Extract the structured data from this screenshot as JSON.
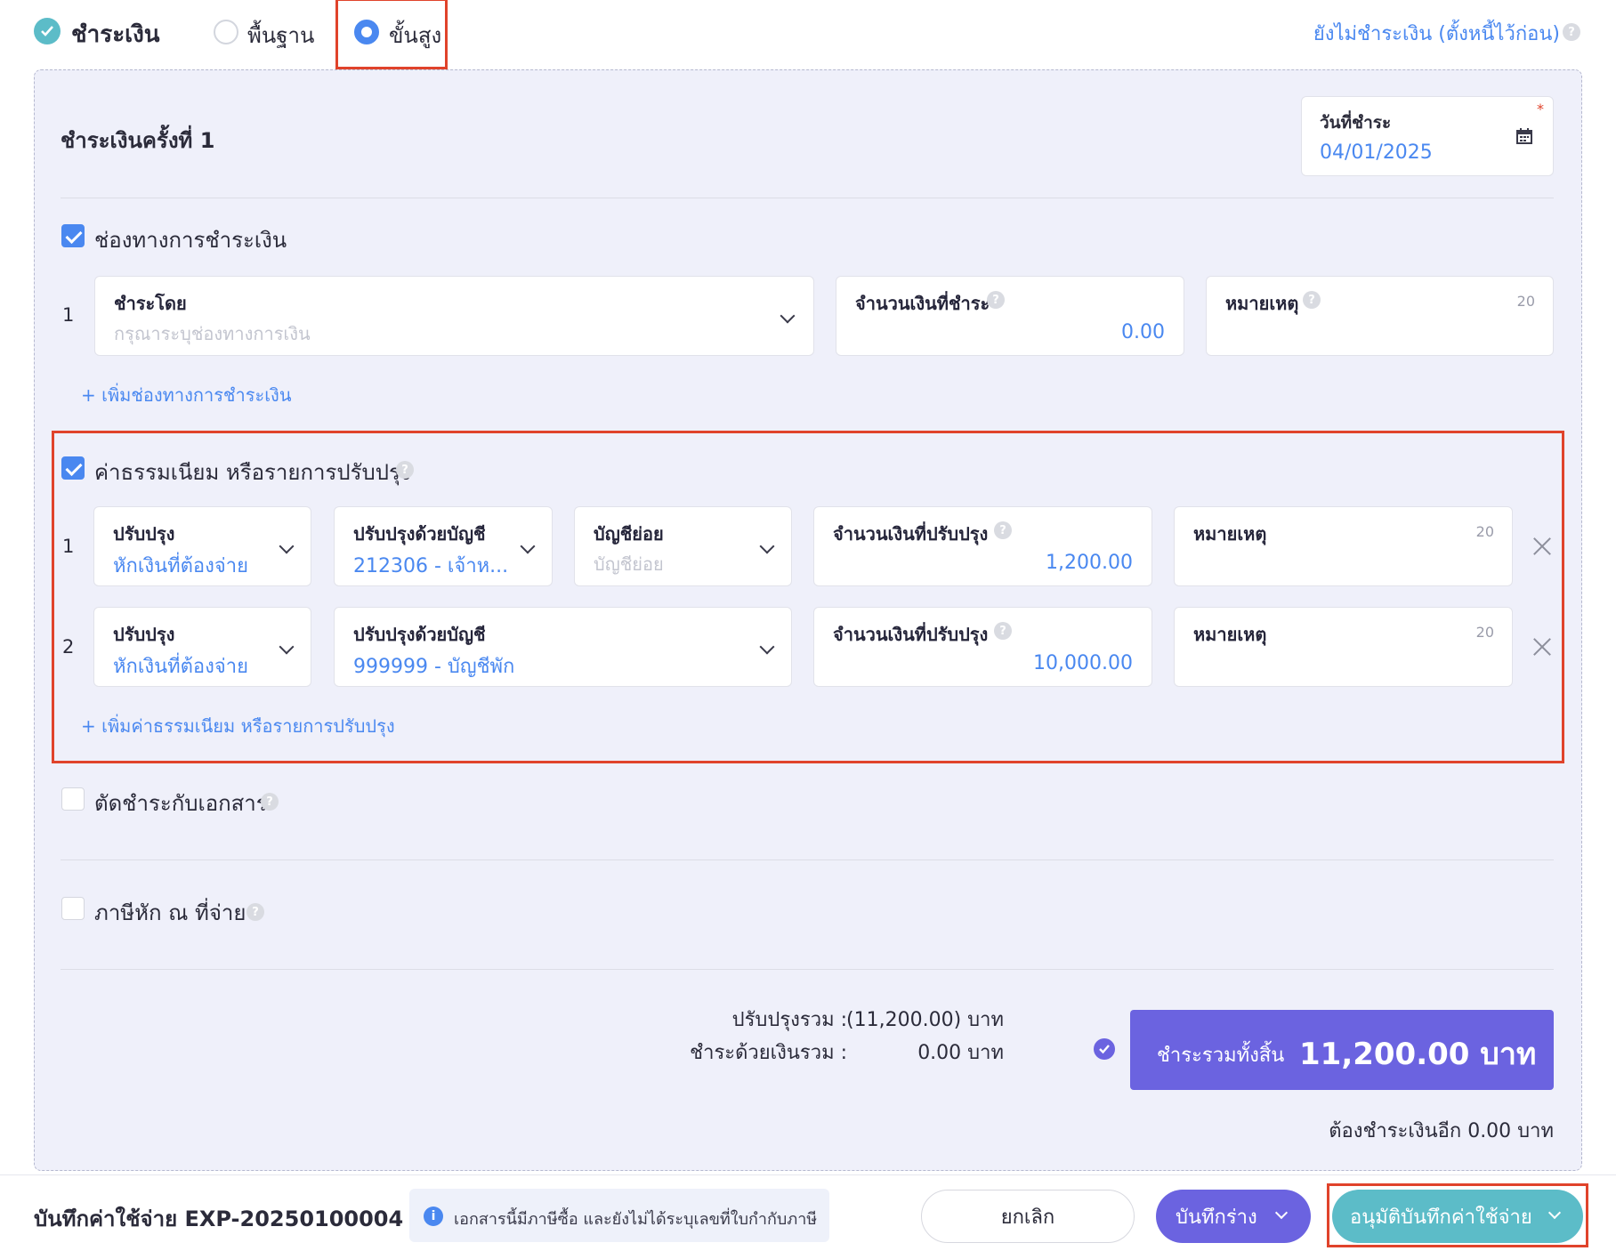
{
  "topbar": {
    "title": "ชำระเงิน",
    "mode_basic": "พื้นฐาน",
    "mode_advanced": "ขั้นสูง",
    "unpaid_link": "ยังไม่ชำระเงิน (ตั้งหนี้ไว้ก่อน)"
  },
  "payment": {
    "heading": "ชำระเงินครั้งที่ 1",
    "date_label": "วันที่ชำระ",
    "date_value": "04/01/2025",
    "required_mark": "*"
  },
  "channels": {
    "checkbox_label": "ช่องทางการชำระเงิน",
    "rows": [
      {
        "num": "1",
        "pay_by_label": "ชำระโดย",
        "pay_by_placeholder": "กรุณาระบุช่องทางการเงิน",
        "amount_label": "จำนวนเงินที่ชำระ",
        "amount_value": "0.00",
        "note_label": "หมายเหตุ",
        "note_counter": "20"
      }
    ],
    "add_link": "+ เพิ่มช่องทางการชำระเงิน"
  },
  "adjustments": {
    "checkbox_label": "ค่าธรรมเนียม หรือรายการปรับปรุง",
    "rows": [
      {
        "num": "1",
        "adjust_label": "ปรับปรุง",
        "adjust_value": "หักเงินที่ต้องจ่าย",
        "account_label": "ปรับปรุงด้วยบัญชี",
        "account_value": "212306 - เจ้าห...",
        "subaccount_label": "บัญชีย่อย",
        "subaccount_placeholder": "บัญชีย่อย",
        "amount_label": "จำนวนเงินที่ปรับปรุง",
        "amount_value": "1,200.00",
        "note_label": "หมายเหตุ",
        "note_counter": "20"
      },
      {
        "num": "2",
        "adjust_label": "ปรับปรุง",
        "adjust_value": "หักเงินที่ต้องจ่าย",
        "account_label": "ปรับปรุงด้วยบัญชี",
        "account_value": "999999 - บัญชีพัก",
        "amount_label": "จำนวนเงินที่ปรับปรุง",
        "amount_value": "10,000.00",
        "note_label": "หมายเหตุ",
        "note_counter": "20"
      }
    ],
    "add_link": "+ เพิ่มค่าธรรมเนียม หรือรายการปรับปรุง"
  },
  "offset": {
    "checkbox_label": "ตัดชำระกับเอกสาร"
  },
  "withholding": {
    "checkbox_label": "ภาษีหัก ณ ที่จ่าย"
  },
  "summary": {
    "adjust_total_label": "ปรับปรุงรวม :",
    "adjust_total_value": "(11,200.00) บาท",
    "cash_total_label": "ชำระด้วยเงินรวม :",
    "cash_total_value": "0.00 บาท",
    "grand_label": "ชำระรวมทั้งสิ้น",
    "grand_value": "11,200.00 บาท",
    "remaining": "ต้องชำระเงินอีก 0.00 บาท"
  },
  "footer": {
    "doc_title": "บันทึกค่าใช้จ่าย EXP-20250100004",
    "info_text": "เอกสารนี้มีภาษีซื้อ และยังไม่ได้ระบุเลขที่ใบกำกับภาษี",
    "cancel": "ยกเลิก",
    "save_draft": "บันทึกร่าง",
    "approve": "อนุมัติบันทึกค่าใช้จ่าย"
  },
  "colors": {
    "accent_blue": "#4a88f0",
    "teal": "#5cbcc8",
    "purple": "#6b63e0",
    "highlight_red": "#e0432b",
    "panel_bg": "#eff0fa"
  }
}
